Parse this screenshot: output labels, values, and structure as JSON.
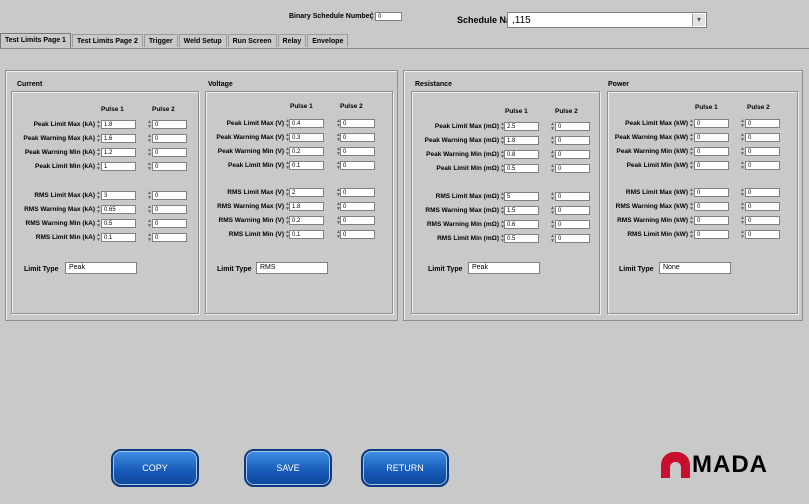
{
  "header": {
    "binary_schedule_label": "Binary Schedule Number",
    "binary_schedule_value": "0",
    "schedule_name_label": "Schedule Name",
    "schedule_name_value": ",115"
  },
  "tabs": [
    {
      "label": "Test Limits Page 1",
      "active": true
    },
    {
      "label": "Test Limits Page 2"
    },
    {
      "label": "Trigger"
    },
    {
      "label": "Weld Setup"
    },
    {
      "label": "Run Screen"
    },
    {
      "label": "Relay"
    },
    {
      "label": "Envelope"
    }
  ],
  "col_headers": {
    "pulse1": "Pulse 1",
    "pulse2": "Pulse 2"
  },
  "limit_type_label": "Limit Type",
  "groups": {
    "current": {
      "title": "Current",
      "rows": [
        {
          "label": "Peak Limit Max (kA)",
          "p1": "1.8",
          "p2": "0"
        },
        {
          "label": "Peak Warning Max (kA)",
          "p1": "1.6",
          "p2": "0"
        },
        {
          "label": "Peak Warning Min (kA)",
          "p1": "1.2",
          "p2": "0"
        },
        {
          "label": "Peak Limit Min (kA)",
          "p1": "1",
          "p2": "0"
        },
        {
          "label": "RMS Limit Max (kA)",
          "p1": "3",
          "p2": "0"
        },
        {
          "label": "RMS Warning Max (kA)",
          "p1": "0.65",
          "p2": "0"
        },
        {
          "label": "RMS Warning Min (kA)",
          "p1": "0.5",
          "p2": "0"
        },
        {
          "label": "RMS Limit Min (kA)",
          "p1": "0.1",
          "p2": "0"
        }
      ],
      "limit_type": "Peak"
    },
    "voltage": {
      "title": "Voltage",
      "rows": [
        {
          "label": "Peak Limit Max (V)",
          "p1": "0.4",
          "p2": "0"
        },
        {
          "label": "Peak Warning Max (V)",
          "p1": "0.3",
          "p2": "0"
        },
        {
          "label": "Peak Warning Min (V)",
          "p1": "0.2",
          "p2": "0"
        },
        {
          "label": "Peak Limit Min (V)",
          "p1": "0.1",
          "p2": "0"
        },
        {
          "label": "RMS Limit Max (V)",
          "p1": "2",
          "p2": "0"
        },
        {
          "label": "RMS Warning Max (V)",
          "p1": "1.8",
          "p2": "0"
        },
        {
          "label": "RMS Warning Min (V)",
          "p1": "0.2",
          "p2": "0"
        },
        {
          "label": "RMS Limit Min (V)",
          "p1": "0.1",
          "p2": "0"
        }
      ],
      "limit_type": "RMS"
    },
    "resistance": {
      "title": "Resistance",
      "rows": [
        {
          "label": "Peak Limit Max (mΩ)",
          "p1": "2.5",
          "p2": "0"
        },
        {
          "label": "Peak Warning Max (mΩ)",
          "p1": "1.8",
          "p2": "0"
        },
        {
          "label": "Peak Warning Min (mΩ)",
          "p1": "0.8",
          "p2": "0"
        },
        {
          "label": "Peak Limit Min (mΩ)",
          "p1": "0.5",
          "p2": "0"
        },
        {
          "label": "RMS Limit Max (mΩ)",
          "p1": "5",
          "p2": "0"
        },
        {
          "label": "RMS Warning Max (mΩ)",
          "p1": "1.5",
          "p2": "0"
        },
        {
          "label": "RMS Warning Min (mΩ)",
          "p1": "0.6",
          "p2": "0"
        },
        {
          "label": "RMS Limit Min (mΩ)",
          "p1": "0.5",
          "p2": "0"
        }
      ],
      "limit_type": "Peak"
    },
    "power": {
      "title": "Power",
      "rows": [
        {
          "label": "Peak Limit Max (kW)",
          "p1": "0",
          "p2": "0"
        },
        {
          "label": "Peak Warning Max (kW)",
          "p1": "0",
          "p2": "0"
        },
        {
          "label": "Peak Warning Min (kW)",
          "p1": "0",
          "p2": "0"
        },
        {
          "label": "Peak Limit Min (kW)",
          "p1": "0",
          "p2": "0"
        },
        {
          "label": "RMS Limit Max (kW)",
          "p1": "0",
          "p2": "0"
        },
        {
          "label": "RMS Warning Max (kW)",
          "p1": "0",
          "p2": "0"
        },
        {
          "label": "RMS Warning Min (kW)",
          "p1": "0",
          "p2": "0"
        },
        {
          "label": "RMS Limit Min (kW)",
          "p1": "0",
          "p2": "0"
        }
      ],
      "limit_type": "None"
    }
  },
  "buttons": {
    "copy": "COPY",
    "save": "SAVE",
    "return": "RETURN"
  },
  "logo": {
    "text": "MADA",
    "brand_color": "#c8102e"
  },
  "colors": {
    "button_blue": "#1759b8",
    "background": "#c9c9c9"
  }
}
